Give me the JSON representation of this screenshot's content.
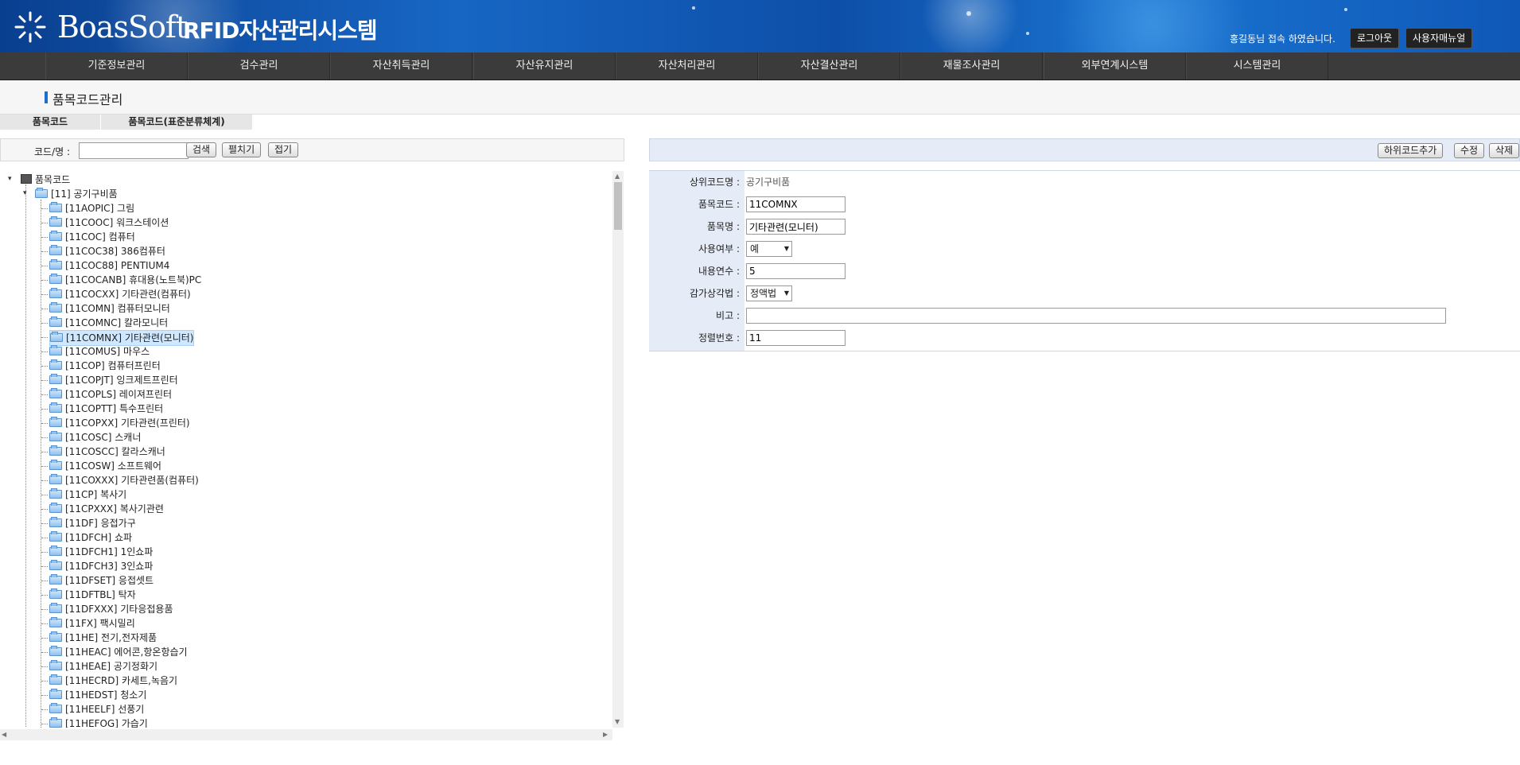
{
  "header": {
    "brand": "BoasSoft",
    "system_name": "RFID자산관리시스템",
    "welcome": "홍길동님 접속 하였습니다.",
    "logout_label": "로그아웃",
    "manual_label": "사용자매뉴얼"
  },
  "nav": [
    "기준정보관리",
    "검수관리",
    "자산취득관리",
    "자산유지관리",
    "자산처리관리",
    "자산결산관리",
    "재물조사관리",
    "외부연계시스템",
    "시스템관리"
  ],
  "page_title": "품목코드관리",
  "tabs": [
    "품목코드",
    "품목코드(표준분류체계)"
  ],
  "search": {
    "label": "코드/명 :",
    "value": "",
    "search_label": "검색",
    "expand_label": "펼치기",
    "collapse_label": "접기"
  },
  "tree": {
    "root": "품목코드",
    "group": "[11] 공기구비품",
    "items": [
      "[11AOPIC] 그림",
      "[11COOC] 워크스테이션",
      "[11COC] 컴퓨터",
      "[11COC38] 386컴퓨터",
      "[11COC88] PENTIUM4",
      "[11COCANB] 휴대용(노트북)PC",
      "[11COCXX] 기타관련(컴퓨터)",
      "[11COMN] 컴퓨터모니터",
      "[11COMNC] 칼라모니터",
      "[11COMNX] 기타관련(모니터)",
      "[11COMUS] 마우스",
      "[11COP] 컴퓨터프린터",
      "[11COPJT] 잉크제트프린터",
      "[11COPLS] 레이져프린터",
      "[11COPTT] 특수프린터",
      "[11COPXX] 기타관련(프린터)",
      "[11COSC] 스캐너",
      "[11COSCC] 칼라스캐너",
      "[11COSW] 소프트웨어",
      "[11COXXX] 기타관련품(컴퓨터)",
      "[11CP] 복사기",
      "[11CPXXX] 복사기관련",
      "[11DF] 응접가구",
      "[11DFCH] 쇼파",
      "[11DFCH1] 1인쇼파",
      "[11DFCH3] 3인쇼파",
      "[11DFSET] 응접셋트",
      "[11DFTBL] 탁자",
      "[11DFXXX] 기타응접용품",
      "[11FX] 팩시밀리",
      "[11HE] 전기,전자제품",
      "[11HEAC] 에어콘,항온항습기",
      "[11HEAE] 공기정화기",
      "[11HECRD] 카세트,녹음기",
      "[11HEDST] 청소기",
      "[11HEELF] 선풍기",
      "[11HEFOG] 가습기"
    ],
    "selected_index": 9
  },
  "detail": {
    "add_child_label": "하위코드추가",
    "edit_label": "수정",
    "delete_label": "삭제",
    "fields": {
      "parent_label": "상위코드명 :",
      "parent_value": "공기구비품",
      "code_label": "품목코드 :",
      "code_value": "11COMNX",
      "name_label": "품목명 :",
      "name_value": "기타관련(모니터)",
      "use_label": "사용여부 :",
      "use_value": "예",
      "life_label": "내용연수 :",
      "life_value": "5",
      "depr_label": "감가상각법 :",
      "depr_value": "정액법",
      "note_label": "비고 :",
      "note_value": "",
      "order_label": "정렬번호 :",
      "order_value": "11"
    }
  }
}
